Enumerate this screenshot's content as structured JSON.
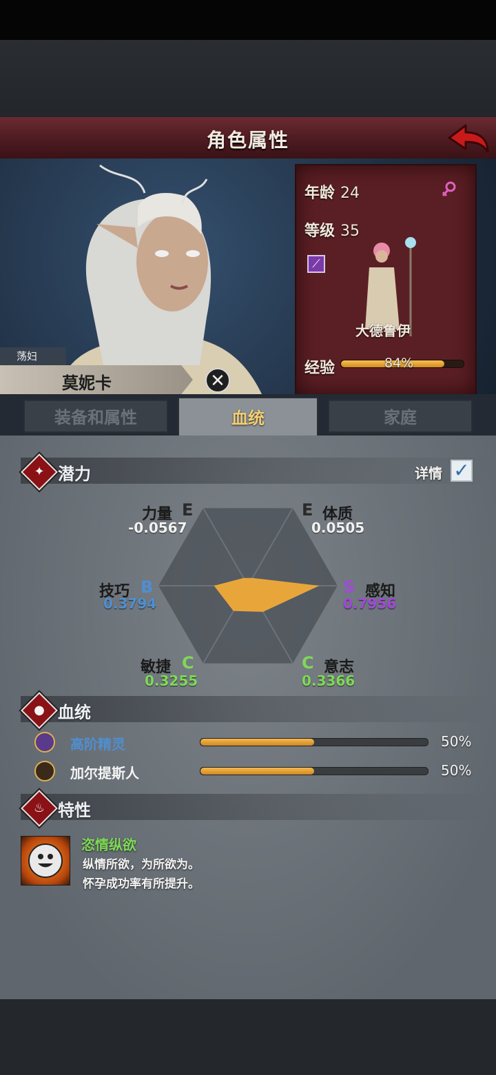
{
  "header": {
    "title": "角色属性"
  },
  "character": {
    "title_tag": "荡妇",
    "name": "莫妮卡",
    "age_label": "年龄",
    "age": "24",
    "level_label": "等级",
    "level": "35",
    "class_name": "大德鲁伊",
    "exp_label": "经验",
    "exp_percent_text": "84%",
    "exp_fraction": 0.84
  },
  "tabs": [
    {
      "label": "装备和属性"
    },
    {
      "label": "血统"
    },
    {
      "label": "家庭"
    }
  ],
  "potential": {
    "title": "潜力",
    "details_label": "详情",
    "stats": {
      "strength": {
        "name": "力量",
        "grade": "E",
        "value": "-0.0567"
      },
      "constitution": {
        "name": "体质",
        "grade": "E",
        "value": "0.0505"
      },
      "skill": {
        "name": "技巧",
        "grade": "B",
        "value": "0.3794"
      },
      "perception": {
        "name": "感知",
        "grade": "S",
        "value": "0.7956"
      },
      "agility": {
        "name": "敏捷",
        "grade": "C",
        "value": "0.3255"
      },
      "will": {
        "name": "意志",
        "grade": "C",
        "value": "0.3366"
      }
    }
  },
  "bloodline": {
    "title": "血统",
    "items": [
      {
        "name": "高阶精灵",
        "percent_text": "50%",
        "fraction": 0.5
      },
      {
        "name": "加尔提斯人",
        "percent_text": "50%",
        "fraction": 0.5
      }
    ]
  },
  "traits": {
    "title": "特性",
    "items": [
      {
        "name": "恣情纵欲",
        "desc_line1": "纵情所欲，为所欲为。",
        "desc_line2": "怀孕成功率有所提升。"
      }
    ]
  },
  "colors": {
    "grade_E": "#2a2a2a",
    "grade_B": "#4f8fd0",
    "grade_S": "#a04ad8",
    "grade_C": "#7ed957",
    "radar_fill": "#e8a63a",
    "bloodline_elf_text": "#4f8fd0",
    "bloodline_human_text": "#f4f4f4"
  },
  "icons": [
    "back-arrow-icon",
    "female-icon",
    "staff-icon",
    "close-icon",
    "potential-icon",
    "blood-drop-icon",
    "trait-fire-icon",
    "check-icon",
    "high-elf-icon",
    "galtis-icon",
    "smile-face-icon"
  ]
}
